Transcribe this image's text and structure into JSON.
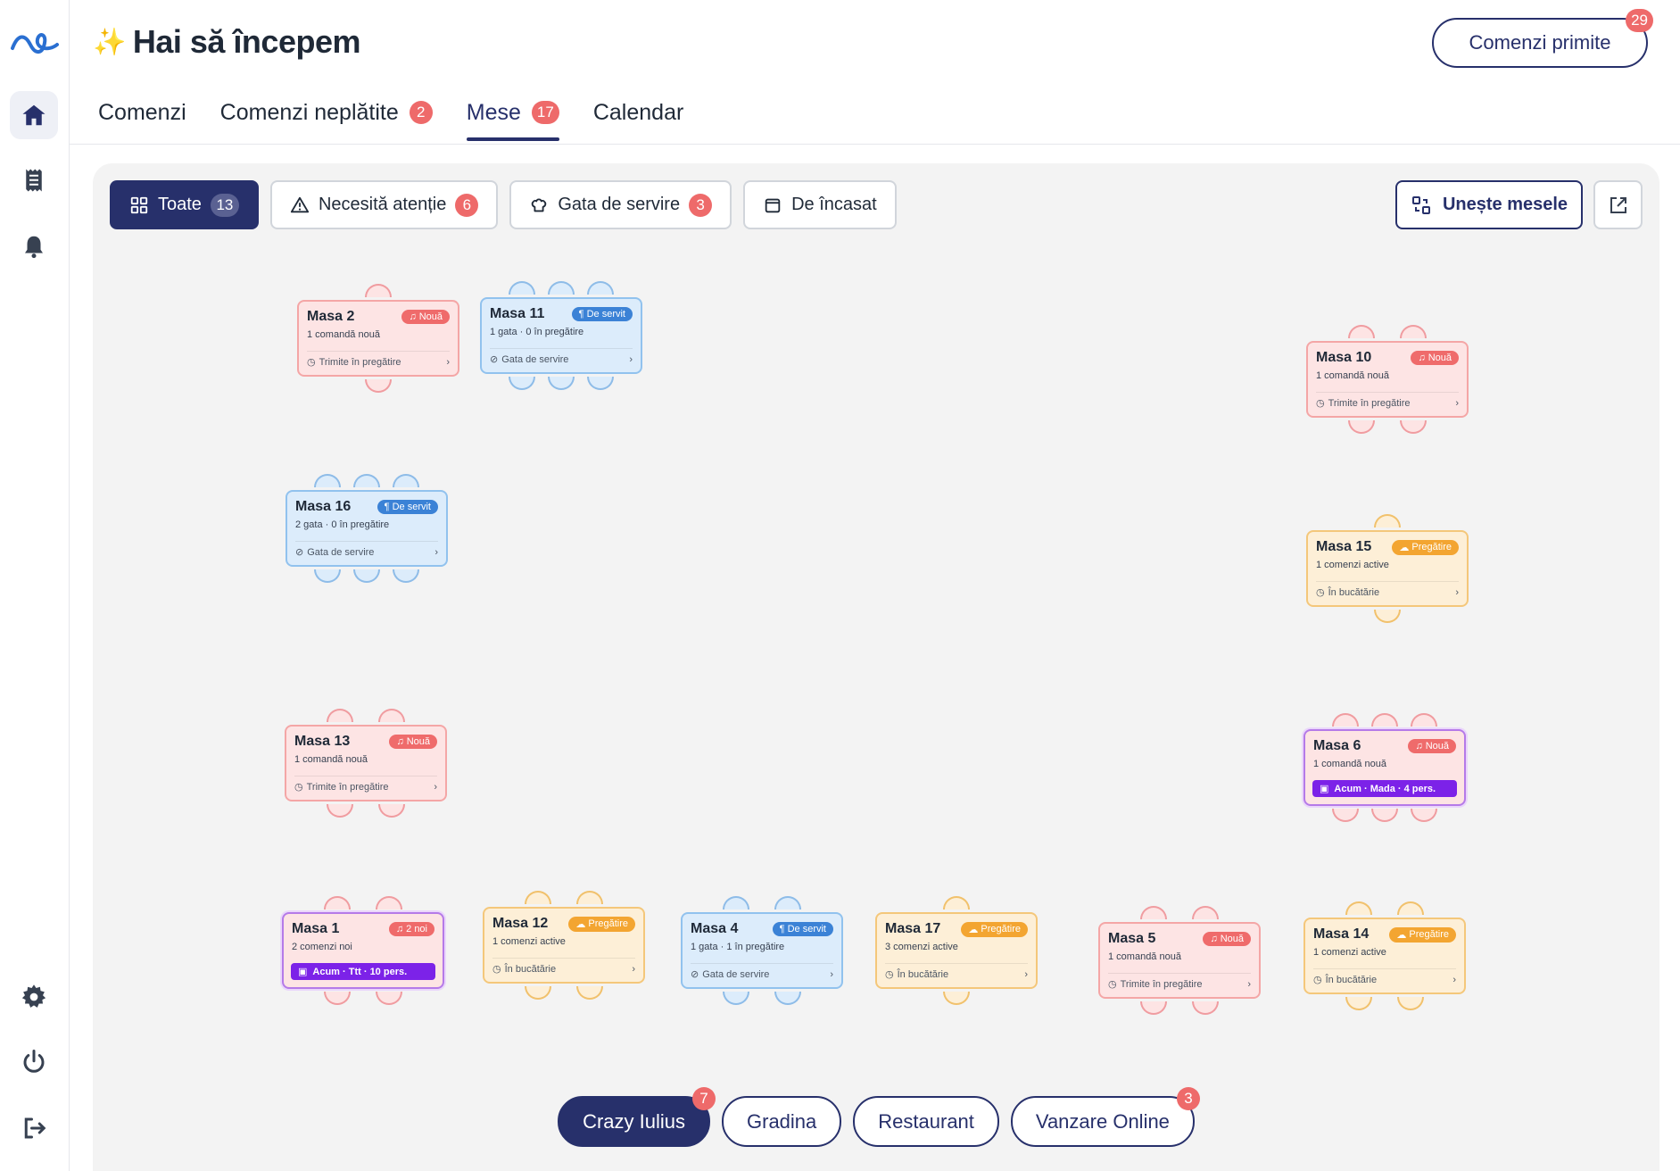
{
  "header": {
    "title": "Hai să începem",
    "orders_button": "Comenzi primite",
    "orders_count": "29"
  },
  "tabs": [
    {
      "label": "Comenzi",
      "count": ""
    },
    {
      "label": "Comenzi neplătite",
      "count": "2"
    },
    {
      "label": "Mese",
      "count": "17"
    },
    {
      "label": "Calendar",
      "count": ""
    }
  ],
  "filters": [
    {
      "label": "Toate",
      "count": "13"
    },
    {
      "label": "Necesită atenție",
      "count": "6"
    },
    {
      "label": "Gata de servire",
      "count": "3"
    },
    {
      "label": "De încasat",
      "count": ""
    }
  ],
  "merge_button": "Unește mesele",
  "tables": [
    {
      "name": "Masa 2",
      "status": "Nouă",
      "line": "1 comandă nouă",
      "foot": "Trimite în pregătire"
    },
    {
      "name": "Masa 11",
      "status": "De servit",
      "line": "1 gata · 0 în pregătire",
      "foot": "Gata de servire"
    },
    {
      "name": "Masa 10",
      "status": "Nouă",
      "line": "1 comandă nouă",
      "foot": "Trimite în pregătire"
    },
    {
      "name": "Masa 16",
      "status": "De servit",
      "line": "2 gata · 0 în pregătire",
      "foot": "Gata de servire"
    },
    {
      "name": "Masa 15",
      "status": "Pregătire",
      "line": "1 comenzi active",
      "foot": "În bucătărie"
    },
    {
      "name": "Masa 13",
      "status": "Nouă",
      "line": "1 comandă nouă",
      "foot": "Trimite în pregătire"
    },
    {
      "name": "Masa 6",
      "status": "Nouă",
      "line": "1 comandă nouă",
      "foot": "Acum · Mada · 4 pers."
    },
    {
      "name": "Masa 1",
      "status": "2 noi",
      "line": "2 comenzi noi",
      "foot": "Acum · Ttt · 10 pers."
    },
    {
      "name": "Masa 12",
      "status": "Pregătire",
      "line": "1 comenzi active",
      "foot": "În bucătărie"
    },
    {
      "name": "Masa 4",
      "status": "De servit",
      "line": "1 gata · 1 în pregătire",
      "foot": "Gata de servire"
    },
    {
      "name": "Masa 17",
      "status": "Pregătire",
      "line": "3 comenzi active",
      "foot": "În bucătărie"
    },
    {
      "name": "Masa 5",
      "status": "Nouă",
      "line": "1 comandă nouă",
      "foot": "Trimite în pregătire"
    },
    {
      "name": "Masa 14",
      "status": "Pregătire",
      "line": "1 comenzi active",
      "foot": "În bucătărie"
    }
  ],
  "areas": [
    {
      "label": "Crazy Iulius",
      "count": "7"
    },
    {
      "label": "Gradina",
      "count": ""
    },
    {
      "label": "Restaurant",
      "count": ""
    },
    {
      "label": "Vanzare Online",
      "count": "3"
    }
  ],
  "colors": {
    "primary": "#27306b",
    "badge": "#ee6a6a",
    "new": "#ef6b6b",
    "serve": "#3b82d6",
    "prep": "#f3a531",
    "reservation": "#7c22e8"
  }
}
